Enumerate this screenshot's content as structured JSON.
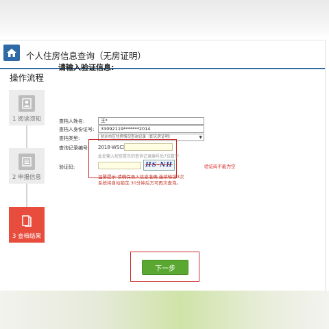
{
  "page": {
    "title": "个人住房信息查询（无房证明）",
    "section_heading": "操作流程"
  },
  "steps": [
    {
      "label": "1 阅读须知",
      "icon": "person-icon"
    },
    {
      "label": "2 申报信息",
      "icon": "list-icon"
    },
    {
      "label": "3 查档结果",
      "icon": "book-icon",
      "active": true
    }
  ],
  "form": {
    "title": "请输入验证信息:",
    "name_label": "查档人姓名:",
    "name_value": "王*",
    "id_label": "查档人身份证号:",
    "id_value": "33092119*******2014",
    "type_label": "查档类型:",
    "type_value": "杭州市区住房情况查询记录（即无房证明）",
    "record_label": "查询记录编号:",
    "record_prefix": "2018-WSCX-",
    "record_hint": "此处输入短信提示的查询记录编号后7位数字",
    "captcha_label": "验证码:",
    "captcha_text": "HS·NH",
    "captcha_error": "验证码不能为空",
    "notice": "温馨提示:请确保录入信息准确,连续输错3次系统将自动锁定,30分钟后方可再次查询。"
  },
  "buttons": {
    "next": "下一步"
  },
  "colors": {
    "brand_blue": "#2f6aa6",
    "active_step": "#e84c3d",
    "next_button": "#5aa832",
    "highlight_red": "#cc2a2a"
  }
}
